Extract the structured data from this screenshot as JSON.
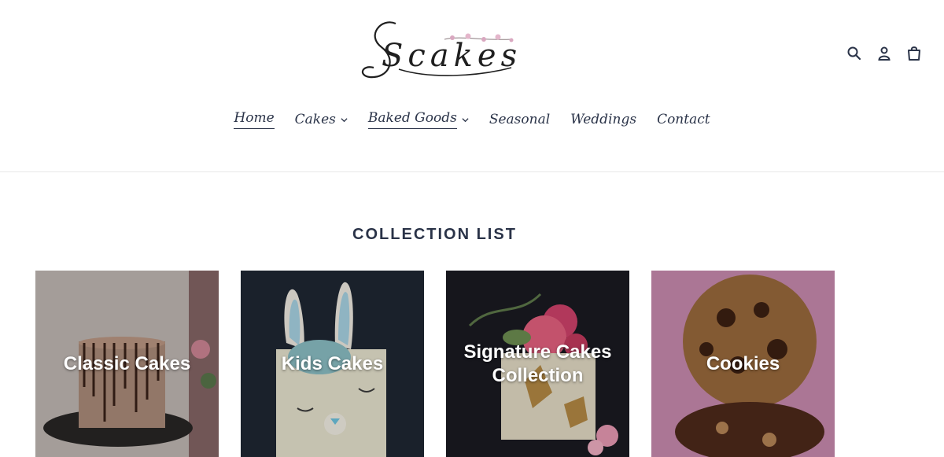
{
  "brand": {
    "logo_text": "Scakes"
  },
  "header_icons": [
    {
      "name": "search-icon"
    },
    {
      "name": "account-icon"
    },
    {
      "name": "cart-icon"
    }
  ],
  "nav": {
    "items": [
      {
        "label": "Home",
        "active": true,
        "dropdown": false
      },
      {
        "label": "Cakes",
        "active": false,
        "dropdown": true
      },
      {
        "label": "Baked Goods",
        "active": true,
        "dropdown": true
      },
      {
        "label": "Seasonal",
        "active": false,
        "dropdown": false
      },
      {
        "label": "Weddings",
        "active": false,
        "dropdown": false
      },
      {
        "label": "Contact",
        "active": false,
        "dropdown": false
      }
    ]
  },
  "section": {
    "title": "COLLECTION LIST"
  },
  "collections": [
    {
      "label": "Classic Cakes"
    },
    {
      "label": "Kids Cakes"
    },
    {
      "label": "Signature Cakes Collection"
    },
    {
      "label": "Cookies"
    }
  ],
  "colors": {
    "text": "#2a3348",
    "divider": "#e8e8e8",
    "overlay": "#000000"
  }
}
